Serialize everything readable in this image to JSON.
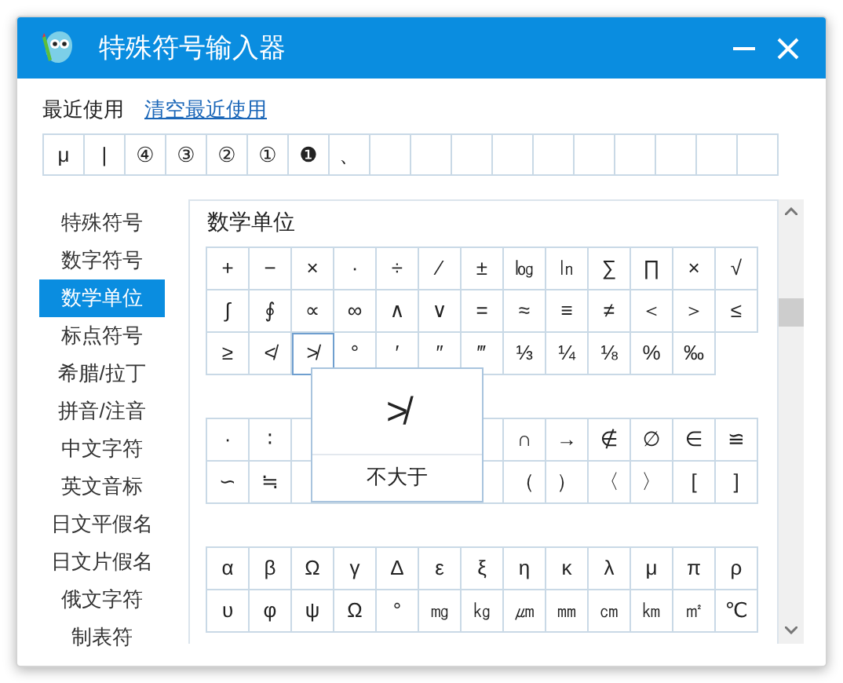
{
  "window": {
    "title": "特殊符号输入器"
  },
  "recent": {
    "label": "最近使用",
    "clear_link": "清空最近使用",
    "symbols": [
      "μ",
      "|",
      "④",
      "③",
      "②",
      "①",
      "❶",
      "、"
    ]
  },
  "sidebar": {
    "items": [
      {
        "label": "特殊符号",
        "selected": false
      },
      {
        "label": "数字符号",
        "selected": false
      },
      {
        "label": "数学单位",
        "selected": true
      },
      {
        "label": "标点符号",
        "selected": false
      },
      {
        "label": "希腊/拉丁",
        "selected": false
      },
      {
        "label": "拼音/注音",
        "selected": false
      },
      {
        "label": "中文字符",
        "selected": false
      },
      {
        "label": "英文音标",
        "selected": false
      },
      {
        "label": "日文平假名",
        "selected": false
      },
      {
        "label": "日文片假名",
        "selected": false
      },
      {
        "label": "俄文字符",
        "selected": false
      },
      {
        "label": "制表符",
        "selected": false
      }
    ]
  },
  "panel": {
    "title": "数学单位",
    "grids": [
      {
        "rows": [
          [
            "+",
            "−",
            "×",
            "·",
            "÷",
            "∕",
            "±",
            "㏒",
            "㏑",
            "∑",
            "∏",
            "×",
            "√"
          ],
          [
            "∫",
            "∮",
            "∝",
            "∞",
            "∧",
            "∨",
            "=",
            "≈",
            "≡",
            "≠",
            "＜",
            "＞",
            "≤"
          ],
          [
            "≥",
            "≮",
            {
              "text": "≯",
              "hovered": true
            },
            "°",
            "′",
            "″",
            "‴",
            "⅓",
            "¼",
            "⅛",
            "%",
            "‰"
          ]
        ]
      },
      {
        "rows": [
          [
            "·",
            "∶",
            null,
            null,
            null,
            null,
            null,
            "∩",
            "→",
            "∉",
            "∅",
            "∈",
            "≌"
          ],
          [
            "∽",
            "≒",
            null,
            null,
            null,
            null,
            null,
            "（",
            "）",
            "〈",
            "〉",
            "[",
            "]"
          ]
        ]
      },
      {
        "rows": [
          [
            "α",
            "β",
            "Ω",
            "γ",
            "Δ",
            "ε",
            "ξ",
            "η",
            "κ",
            "λ",
            "μ",
            "π",
            "ρ"
          ],
          [
            "υ",
            "φ",
            "ψ",
            "Ω",
            "°",
            "㎎",
            "㎏",
            "㎛",
            "㎜",
            "㎝",
            "㎞",
            "㎡",
            "℃"
          ]
        ]
      }
    ],
    "popup": {
      "symbol": "≯",
      "label": "不大于"
    }
  }
}
